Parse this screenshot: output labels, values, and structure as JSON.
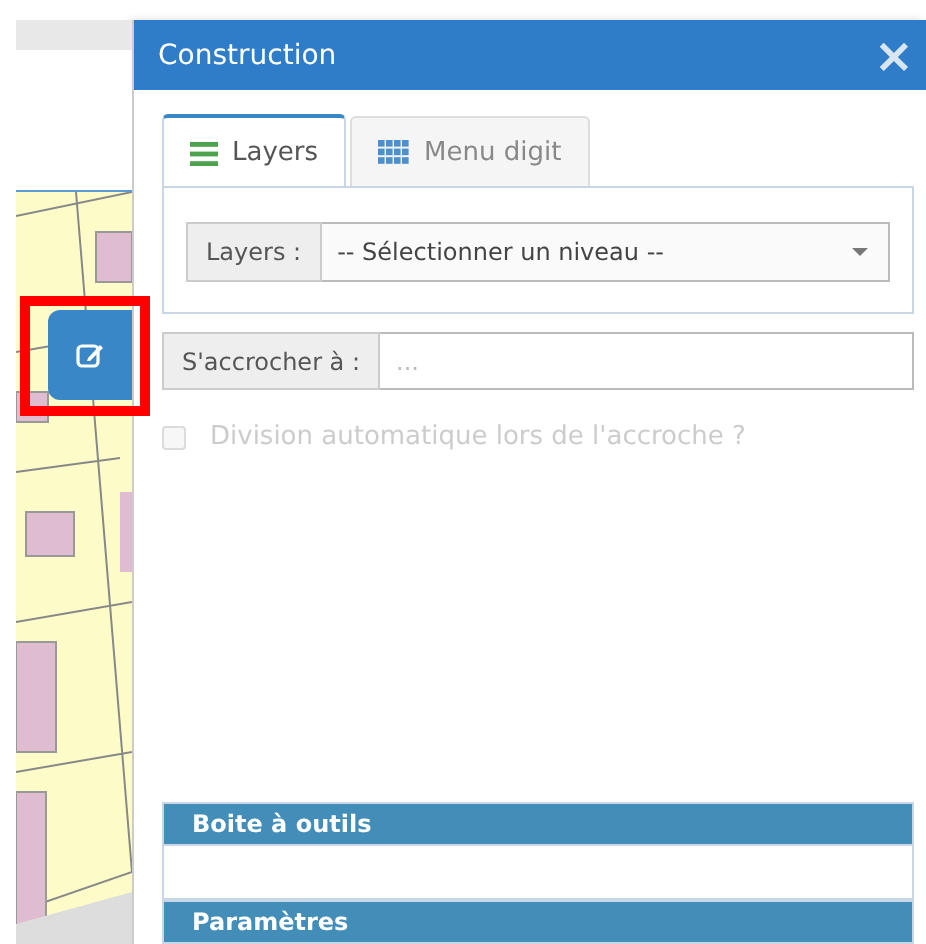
{
  "edit_button": {
    "highlighted": true
  },
  "panel": {
    "title": "Construction",
    "close": "×"
  },
  "tabs": [
    {
      "label": "Layers",
      "selected": true
    },
    {
      "label": "Menu digit",
      "selected": false
    }
  ],
  "layers_field": {
    "label": "Layers :",
    "value": "-- Sélectionner un niveau --"
  },
  "snap_field": {
    "label": "S'accrocher à :",
    "placeholder": "..."
  },
  "auto_split": {
    "label": "Division automatique lors de l'accroche ?",
    "checked": false,
    "disabled": true
  },
  "sections": [
    {
      "title": "Boite à outils",
      "expanded": true
    },
    {
      "title": "Paramètres",
      "expanded": false
    }
  ]
}
